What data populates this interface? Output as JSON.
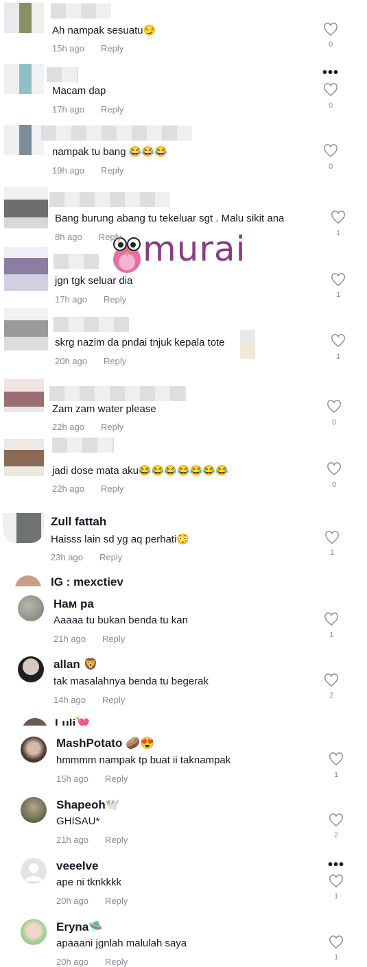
{
  "watermark": "murai",
  "reply_label": "Reply",
  "more_label": "•••",
  "comments": [
    {
      "name": "",
      "text": "Ah nampak sesuatu😏",
      "time": "15h ago",
      "likes": "0"
    },
    {
      "name": "",
      "text": "Macam dap",
      "time": "17h ago",
      "likes": "0"
    },
    {
      "name": "",
      "text": "nampak tu bang 😂😂😂",
      "time": "19h ago",
      "likes": "0"
    },
    {
      "name": "",
      "text": "Bang burung abang tu tekeluar sgt . Malu sikit ana",
      "time": "8h ago",
      "likes": "1"
    },
    {
      "name": "",
      "text": "jgn tgk seluar dia",
      "time": "17h ago",
      "likes": "1"
    },
    {
      "name": "",
      "text": "skrg nazim da pndai tnjuk kepala tote",
      "time": "20h ago",
      "likes": "1"
    },
    {
      "name": "",
      "text": "Zam zam water please",
      "time": "22h ago",
      "likes": "0"
    },
    {
      "name": "",
      "text": "jadi dose mata aku😂😂😂😂😂😂😂",
      "time": "22h ago",
      "likes": "0"
    },
    {
      "name": "Zull fattah",
      "text": "Haisss lain sd yg aq perhati😳",
      "time": "23h ago",
      "likes": "1"
    },
    {
      "name": "Нам pa",
      "text": "Aaaaa tu bukan benda tu kan",
      "time": "21h ago",
      "likes": "1"
    },
    {
      "name": "allan 🦁",
      "text": "tak masalahnya benda tu begerak",
      "time": "14h ago",
      "likes": "2"
    },
    {
      "name": "MashPotato 🥔😍",
      "text": "hmmmm nampak tp buat ii taknampak",
      "time": "15h ago",
      "likes": "1"
    },
    {
      "name": "Shapeoh🕊️",
      "text": "GHISAU*",
      "time": "21h ago",
      "likes": "2"
    },
    {
      "name": "veeelve",
      "text": "ape ni tknkkkk",
      "time": "20h ago",
      "likes": "1"
    },
    {
      "name": "Eryna🛸",
      "text": "apaaani jgnlah malulah saya",
      "time": "20h ago",
      "likes": "1"
    }
  ],
  "partial_names": {
    "ig": "IG : mexctiev",
    "luli": "Luli💘"
  },
  "colors": {
    "watermark": "#8a3b86",
    "muted": "#8a8b91",
    "text": "#161823"
  }
}
